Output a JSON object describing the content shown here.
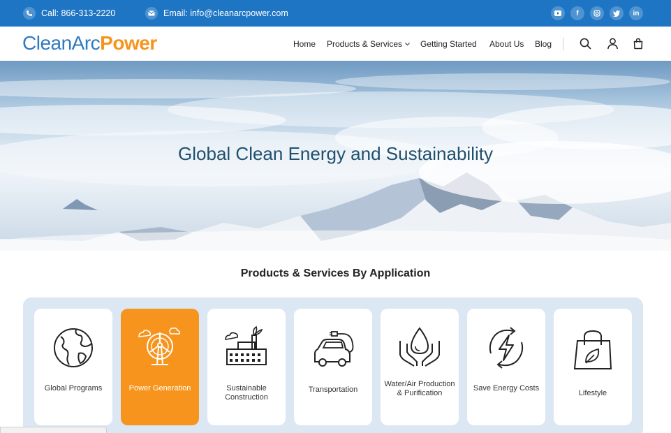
{
  "topbar": {
    "call_text": "Call: 866-313-2220",
    "email_text": "Email: info@cleanarcpower.com",
    "social": [
      "youtube-icon",
      "facebook-icon",
      "instagram-icon",
      "twitter-icon",
      "linkedin-icon"
    ]
  },
  "header": {
    "logo_part1": "CleanArc",
    "logo_part2": "Power",
    "nav": [
      "Home",
      "Products & Services",
      "Getting Started",
      "About Us",
      "Blog"
    ],
    "icons": [
      "search-icon",
      "user-icon",
      "cart-icon"
    ]
  },
  "hero": {
    "title": "Global Clean Energy and Sustainability"
  },
  "section": {
    "title": "Products & Services By Application"
  },
  "cards": [
    {
      "label": "Global Programs",
      "icon": "globe-icon",
      "active": false
    },
    {
      "label": "Power Generation",
      "icon": "wind-turbine-icon",
      "active": true
    },
    {
      "label": "Sustainable Construction",
      "icon": "factory-icon",
      "active": false
    },
    {
      "label": "Transportation",
      "icon": "electric-car-icon",
      "active": false
    },
    {
      "label": "Water/Air Production & Purification",
      "icon": "water-hands-icon",
      "active": false
    },
    {
      "label": "Save Energy Costs",
      "icon": "energy-cycle-icon",
      "active": false
    },
    {
      "label": "Lifestyle",
      "icon": "shopping-bag-icon",
      "active": false
    }
  ],
  "colors": {
    "topbar": "#1e75c3",
    "accent": "#f7941d",
    "logo_blue": "#2f7ac0",
    "panel": "#dbe7f3",
    "hero_title": "#20506d"
  }
}
